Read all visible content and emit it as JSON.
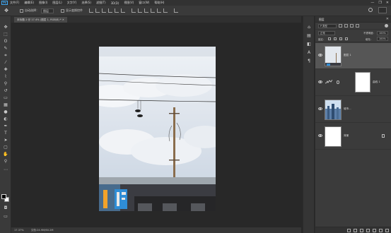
{
  "app": {
    "logo_text": "Ps"
  },
  "menu": [
    "文件(F)",
    "编辑(E)",
    "图像(I)",
    "图层(L)",
    "文字(Y)",
    "选择(S)",
    "滤镜(T)",
    "3D(D)",
    "视图(V)",
    "窗口(W)",
    "帮助(H)"
  ],
  "window_controls": {
    "minimize": "—",
    "restore": "❐",
    "close": "✕"
  },
  "options_bar": {
    "auto_select_label": "自动选择：",
    "auto_select_value": "图层",
    "transform_label": "显示变换控件",
    "tool_glyph": "✥"
  },
  "document_tab": {
    "label": "未标题-1 @ 17.4% (图层 1, RGB/8) *  ✕"
  },
  "status_bar": {
    "zoom": "17.37%",
    "doc_info": "文档:24.9M/60.2M"
  },
  "layers_panel": {
    "title": "图层",
    "close_glyph": "✕",
    "filter_label": "P 类型",
    "blend_mode": "正常",
    "opacity_label": "不透明度：",
    "opacity_value": "100%",
    "lock_label": "锁定：",
    "fill_label": "填充：",
    "fill_value": "100%",
    "layers": [
      {
        "name": "图层 1",
        "selected": true
      },
      {
        "name": "",
        "mask_label": "曲线 1",
        "selected": false
      },
      {
        "name": "城市...",
        "selected": false
      },
      {
        "name": "背景",
        "selected": false
      }
    ]
  },
  "colors": {
    "ui_dark": "#282828",
    "panel": "#3b3b3b",
    "accent": "#3fa9f5",
    "selected_layer": "#565656"
  }
}
